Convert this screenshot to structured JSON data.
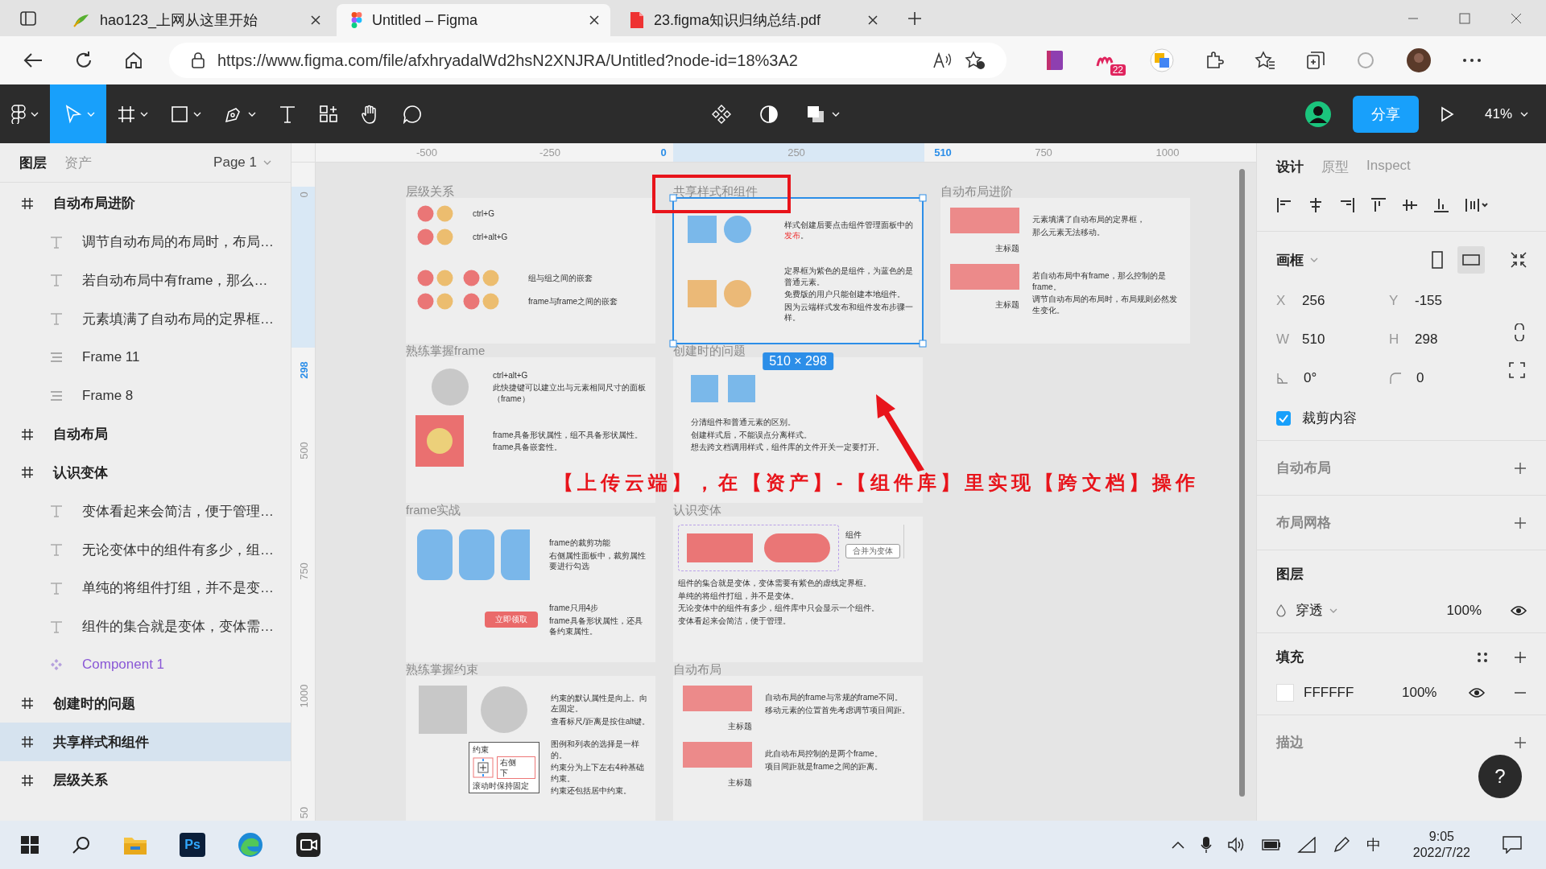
{
  "browser": {
    "tabs": [
      {
        "title": "hao123_上网从这里开始",
        "kind": "hao",
        "selected": false
      },
      {
        "title": "Untitled – Figma",
        "kind": "figma",
        "selected": true
      },
      {
        "title": "23.figma知识归纳总结.pdf",
        "kind": "pdf",
        "selected": false
      }
    ],
    "url": "https://www.figma.com/file/afxhryadalWd2hsN2XNJRA/Untitled?node-id=18%3A2",
    "extension_badge": "22"
  },
  "toolbar": {
    "tools": [
      {
        "kind": "move",
        "selected": true
      },
      {
        "kind": "frame",
        "selected": false
      },
      {
        "kind": "shape",
        "selected": false
      },
      {
        "kind": "pen",
        "selected": false
      },
      {
        "kind": "text",
        "selected": false
      },
      {
        "kind": "resources",
        "selected": false
      },
      {
        "kind": "hand",
        "selected": false
      },
      {
        "kind": "comment",
        "selected": false
      }
    ],
    "share": "分享",
    "zoom": "41%"
  },
  "left_panel": {
    "tabs": [
      {
        "label": "图层",
        "selected": true
      },
      {
        "label": "资产",
        "selected": false
      }
    ],
    "page": "Page 1",
    "layers": [
      {
        "name": "自动布局进阶",
        "kind": "frame",
        "selected": false,
        "children": [
          {
            "name": "调节自动布局的布局时，布局…",
            "kind": "text",
            "selected": false
          },
          {
            "name": "若自动布局中有frame，那么…",
            "kind": "text",
            "selected": false
          },
          {
            "name": "元素填满了自动布局的定界框…",
            "kind": "text",
            "selected": false
          },
          {
            "name": "Frame 11",
            "kind": "autolayout",
            "selected": false
          },
          {
            "name": "Frame 8",
            "kind": "autolayout",
            "selected": false
          }
        ]
      },
      {
        "name": "自动布局",
        "kind": "frame",
        "selected": false
      },
      {
        "name": "认识变体",
        "kind": "frame",
        "selected": false,
        "children": [
          {
            "name": "变体看起来会简洁，便于管理…",
            "kind": "text",
            "selected": false
          },
          {
            "name": "无论变体中的组件有多少，组…",
            "kind": "text",
            "selected": false
          },
          {
            "name": "单纯的将组件打组，并不是变…",
            "kind": "text",
            "selected": false
          },
          {
            "name": "组件的集合就是变体，变体需…",
            "kind": "text",
            "selected": false
          },
          {
            "name": "Component 1",
            "kind": "component",
            "selected": false
          }
        ]
      },
      {
        "name": "创建时的问题",
        "kind": "frame",
        "selected": false
      },
      {
        "name": "共享样式和组件",
        "kind": "frame",
        "selected": true
      },
      {
        "name": "层级关系",
        "kind": "frame",
        "selected": false
      }
    ]
  },
  "rulers": {
    "top": [
      {
        "label": "-500",
        "highlighted": false
      },
      {
        "label": "-250",
        "highlighted": false
      },
      {
        "label": "0",
        "highlighted": true
      },
      {
        "label": "250",
        "highlighted": false
      },
      {
        "label": "510",
        "highlighted": true
      },
      {
        "label": "750",
        "highlighted": false
      },
      {
        "label": "1000",
        "highlighted": false
      }
    ],
    "left": [
      {
        "label": "0",
        "highlighted": false
      },
      {
        "label": "298",
        "highlighted": true
      },
      {
        "label": "500",
        "highlighted": false
      },
      {
        "label": "750",
        "highlighted": false
      },
      {
        "label": "1000",
        "highlighted": false
      },
      {
        "label": "50",
        "highlighted": false
      }
    ]
  },
  "canvas": {
    "columns": [
      [
        {
          "title": "层级关系",
          "kind": "hierarchy",
          "selected": false,
          "rows": [
            {
              "label": "ctrl+G",
              "kind": "single"
            },
            {
              "label": "ctrl+alt+G",
              "kind": "single"
            },
            {
              "label": "组与组之间的嵌套",
              "kind": "double"
            },
            {
              "label": "frame与frame之间的嵌套",
              "kind": "double"
            }
          ]
        },
        {
          "title": "熟练掌握frame",
          "kind": "frame_basics",
          "selected": false,
          "blocks": [
            [
              "ctrl+alt+G",
              "此快捷键可以建立出与元素相同尺寸的面板（frame）"
            ],
            [
              "frame具备形状属性，组不具备形状属性。",
              "frame具备嵌套性。"
            ]
          ]
        },
        {
          "title": "frame实战",
          "kind": "frame_practice",
          "selected": false,
          "button": "立即领取",
          "blocks": [
            [
              "frame的裁剪功能",
              "右侧属性面板中，裁剪属性要进行勾选"
            ],
            [
              "frame只用4步",
              "frame具备形状属性，还具备约束属性。"
            ]
          ]
        },
        {
          "title": "熟练掌握约束",
          "kind": "constraints",
          "selected": false,
          "panel": {
            "title": "约束",
            "options": [
              "右侧",
              "下"
            ],
            "checkbox": "滚动时保持固定"
          },
          "blocks": [
            [
              "约束的默认属性是向上。向左固定。",
              "查看标尺/距离是按住alt键。"
            ],
            [
              "图例和列表的选择是一样的。",
              "约束分为上下左右4种基础约束。",
              "约束还包括居中约束。"
            ]
          ]
        }
      ],
      [
        {
          "title": "共享样式和组件",
          "kind": "shared_styles",
          "selected": true,
          "size_label": "510 × 298",
          "blocks": [
            [
              {
                "text": "样式创建后要点击组件管理面板中的",
                "highlight": "发布",
                "after": "。"
              }
            ],
            [
              {
                "text": "定界框为紫色的是组件，为蓝色的是普通元素。"
              },
              {
                "text": "免费版的用户只能创建本地组件。"
              },
              {
                "text": "因为云端样式发布和组件发布步骤一样。"
              }
            ]
          ]
        },
        {
          "title": "创建时的问题",
          "kind": "creation_issues",
          "selected": false,
          "blocks": [
            [
              "分清组件和普通元素的区别。",
              "创建样式后，不能误点分离样式。",
              "想去跨文档调用样式，组件库的文件开关一定要打开。"
            ]
          ]
        },
        {
          "title": "认识变体",
          "kind": "variants",
          "selected": false,
          "panel": {
            "title": "组件",
            "button": "合并为变体"
          },
          "blocks": [
            [
              "组件的集合就是变体，变体需要有紫色的虚线定界框。",
              "单纯的将组件打组，并不是变体。",
              "无论变体中的组件有多少，组件库中只会显示一个组件。",
              "变体看起来会简洁，便于管理。"
            ]
          ]
        },
        {
          "title": "自动布局",
          "kind": "rows",
          "selected": false,
          "rows": [
            {
              "caption": "主标题",
              "lines": [
                "自动布局的frame与常规的frame不同。",
                "移动元素的位置首先考虑调节项目间距。"
              ]
            },
            {
              "caption": "主标题",
              "lines": [
                "此自动布局控制的是两个frame。",
                "项目间距就是frame之间的距离。"
              ]
            }
          ]
        }
      ],
      [
        {
          "title": "自动布局进阶",
          "kind": "rows",
          "selected": false,
          "rows": [
            {
              "caption": "主标题",
              "lines": [
                "元素填满了自动布局的定界框，",
                "那么元素无法移动。"
              ]
            },
            {
              "caption": "主标题",
              "lines": [
                "若自动布局中有frame，那么控制的是frame。",
                "调节自动布局的布局时，布局规则必然发生变化。"
              ]
            }
          ]
        }
      ]
    ],
    "annotation": "【上传云端】，在【资产】-【组件库】里实现【跨文档】操作"
  },
  "inspector": {
    "tabs": [
      {
        "label": "设计",
        "selected": true
      },
      {
        "label": "原型",
        "selected": false
      },
      {
        "label": "Inspect",
        "selected": false
      }
    ],
    "frame_title": "画框",
    "orientations": [
      {
        "kind": "portrait",
        "selected": false
      },
      {
        "kind": "landscape",
        "selected": true
      }
    ],
    "fields": [
      {
        "label": "X",
        "value": "256"
      },
      {
        "label": "Y",
        "value": "-155"
      },
      {
        "label": "W",
        "value": "510"
      },
      {
        "label": "H",
        "value": "298"
      }
    ],
    "rotation": "0°",
    "radius": "0",
    "clip": {
      "label": "裁剪内容",
      "checked": true
    },
    "sections": [
      "自动布局",
      "布局网格"
    ],
    "layer": {
      "title": "图层",
      "blend": "穿透",
      "opacity": "100%"
    },
    "fill": {
      "title": "填充",
      "color": "FFFFFF",
      "opacity": "100%"
    },
    "stroke": {
      "title": "描边"
    },
    "help": "?"
  },
  "taskbar": {
    "ps_label": "Ps",
    "ime": "中",
    "time": "9:05",
    "date": "2022/7/22"
  }
}
